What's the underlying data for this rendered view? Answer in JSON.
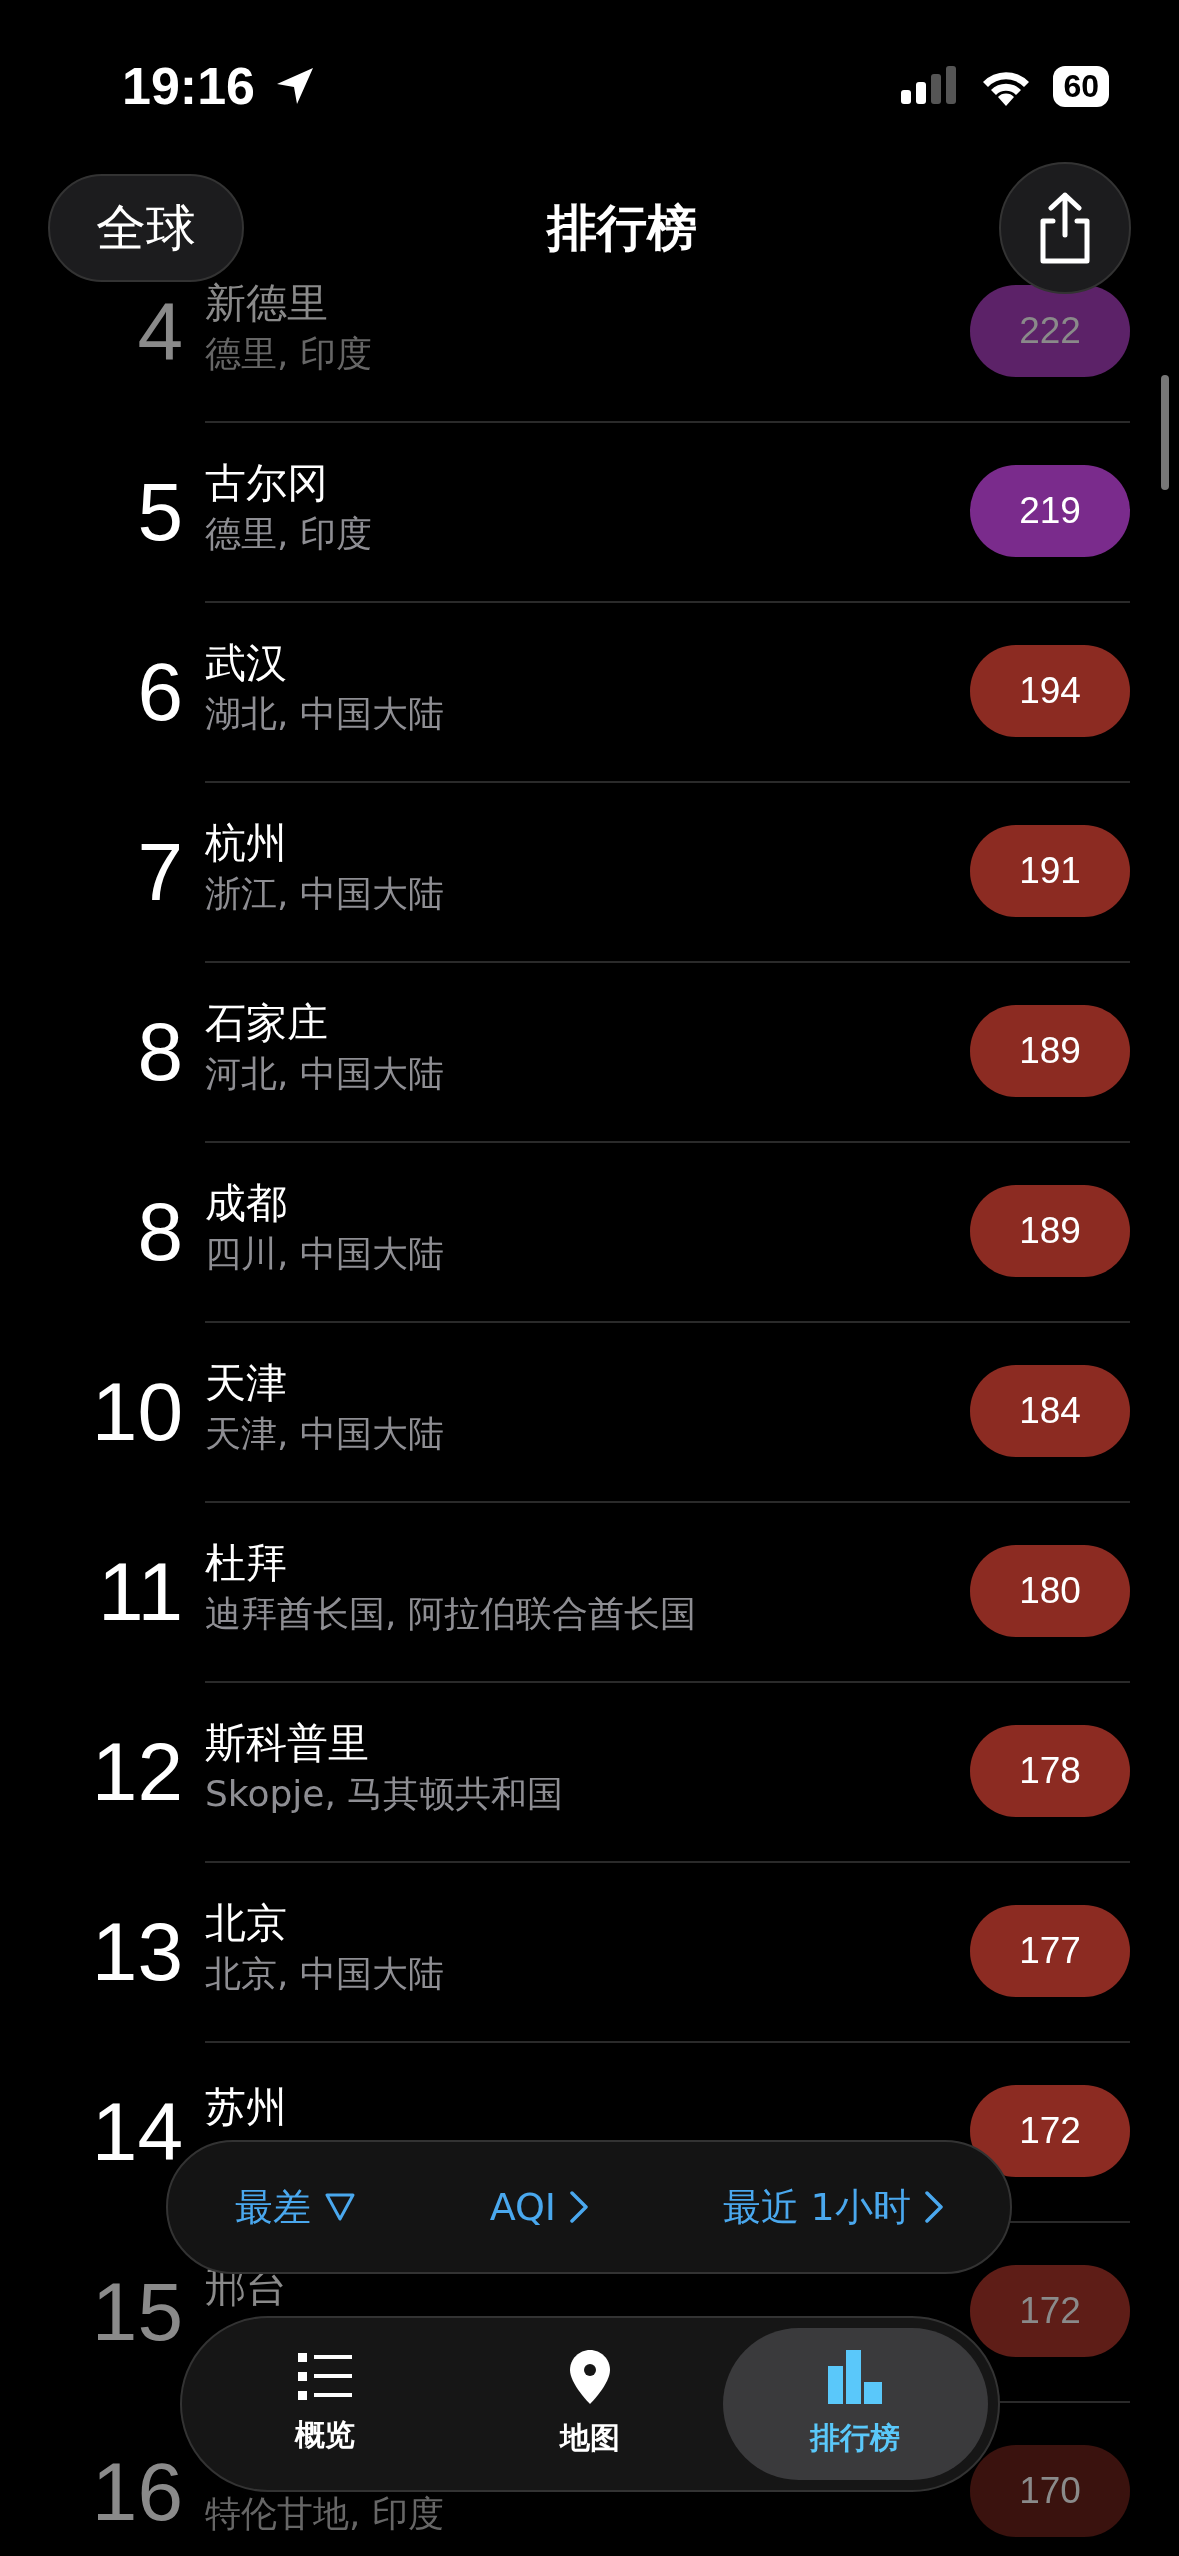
{
  "status_bar": {
    "time": "19:16",
    "battery": "60"
  },
  "header": {
    "scope_button": "全球",
    "title": "排行榜"
  },
  "rows": [
    {
      "rank": "4",
      "name": "新德里",
      "region": "德里, 印度",
      "aqi": "222",
      "color": "#5c2268",
      "faded": true
    },
    {
      "rank": "5",
      "name": "古尔冈",
      "region": "德里, 印度",
      "aqi": "219",
      "color": "#7a2b8c",
      "faded": false
    },
    {
      "rank": "6",
      "name": "武汉",
      "region": "湖北, 中国大陆",
      "aqi": "194",
      "color": "#8c2b22",
      "faded": false
    },
    {
      "rank": "7",
      "name": "杭州",
      "region": "浙江, 中国大陆",
      "aqi": "191",
      "color": "#8c2b22",
      "faded": false
    },
    {
      "rank": "8",
      "name": "石家庄",
      "region": "河北, 中国大陆",
      "aqi": "189",
      "color": "#8c2b22",
      "faded": false
    },
    {
      "rank": "8",
      "name": "成都",
      "region": "四川, 中国大陆",
      "aqi": "189",
      "color": "#8c2b22",
      "faded": false
    },
    {
      "rank": "10",
      "name": "天津",
      "region": "天津, 中国大陆",
      "aqi": "184",
      "color": "#8c2b22",
      "faded": false
    },
    {
      "rank": "11",
      "name": "杜拜",
      "region": "迪拜酋长国, 阿拉伯联合酋长国",
      "aqi": "180",
      "color": "#8c2b22",
      "faded": false
    },
    {
      "rank": "12",
      "name": "斯科普里",
      "region": "Skopje, 马其顿共和国",
      "aqi": "178",
      "color": "#8c2b22",
      "faded": false
    },
    {
      "rank": "13",
      "name": "北京",
      "region": "北京, 中国大陆",
      "aqi": "177",
      "color": "#8c2b22",
      "faded": false
    },
    {
      "rank": "14",
      "name": "苏州",
      "aqi": "172",
      "color": "#8c2b22",
      "faded": false
    },
    {
      "rank": "15",
      "name": "邢台",
      "aqi": "172",
      "color": "#5e1d17",
      "faded": true
    },
    {
      "rank": "16",
      "region": "特伦甘地, 印度",
      "aqi": "170",
      "color": "#3a120e",
      "faded": true
    }
  ],
  "filters": [
    {
      "label": "最差",
      "kind": "triangle"
    },
    {
      "label": "AQI",
      "kind": "chevron"
    },
    {
      "label": "最近 1小时",
      "kind": "chevron"
    }
  ],
  "tabs": [
    {
      "label": "概览",
      "kind": "list",
      "selected": false
    },
    {
      "label": "地图",
      "kind": "pin",
      "selected": false
    },
    {
      "label": "排行榜",
      "kind": "bars",
      "selected": true
    }
  ]
}
